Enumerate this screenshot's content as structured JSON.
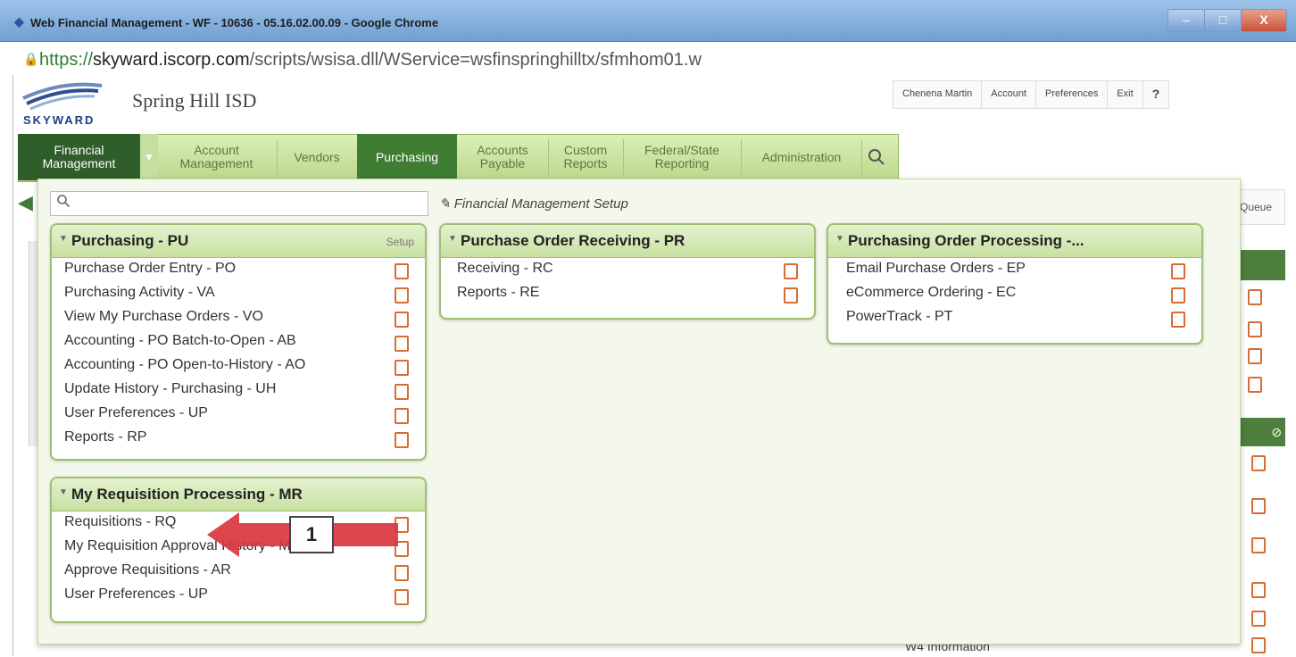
{
  "window": {
    "title": "Web Financial Management - WF - 10636 - 05.16.02.00.09 - Google Chrome",
    "minimize": "–",
    "maximize": "□",
    "close": "X"
  },
  "address": {
    "scheme": "https://",
    "domain": "skyward.iscorp.com",
    "path": "/scripts/wsisa.dll/WService=wsfinspringhilltx/sfmhom01.w"
  },
  "header": {
    "district": "Spring Hill ISD",
    "user": "Chenena Martin",
    "account": "Account",
    "preferences": "Preferences",
    "exit": "Exit",
    "help": "?"
  },
  "nav": {
    "tabs": [
      {
        "label1": "Financial",
        "label2": "Management"
      },
      {
        "label1": "Account",
        "label2": "Management"
      },
      {
        "label1": "Vendors",
        "label2": ""
      },
      {
        "label1": "Purchasing",
        "label2": ""
      },
      {
        "label1": "Accounts",
        "label2": "Payable"
      },
      {
        "label1": "Custom",
        "label2": "Reports"
      },
      {
        "label1": "Federal/State",
        "label2": "Reporting"
      },
      {
        "label1": "Administration",
        "label2": ""
      }
    ]
  },
  "panel": {
    "search_placeholder": "",
    "setup_link": "Financial Management Setup",
    "groups": [
      {
        "title": "Purchasing - PU",
        "setup": "Setup",
        "items": [
          "Purchase Order Entry - PO",
          "Purchasing Activity - VA",
          "View My Purchase Orders - VO",
          "Accounting - PO Batch-to-Open - AB",
          "Accounting - PO Open-to-History - AO",
          "Update History - Purchasing - UH",
          "User Preferences - UP",
          "Reports - RP"
        ]
      },
      {
        "title": "Purchase Order Receiving - PR",
        "items": [
          "Receiving - RC",
          "Reports - RE"
        ]
      },
      {
        "title": "Purchasing Order Processing -...",
        "items": [
          "Email Purchase Orders - EP",
          "eCommerce Ordering - EC",
          "PowerTrack - PT"
        ]
      },
      {
        "title": "My Requisition Processing - MR",
        "items": [
          "Requisitions - RQ",
          "My Requisition Approval History - MR",
          "Approve Requisitions - AR",
          "User Preferences - UP"
        ]
      }
    ]
  },
  "background": {
    "queue": "Queue",
    "w4": "W4 Information"
  },
  "annotation": {
    "number": "1",
    "arrow_color": "#d9363e"
  }
}
